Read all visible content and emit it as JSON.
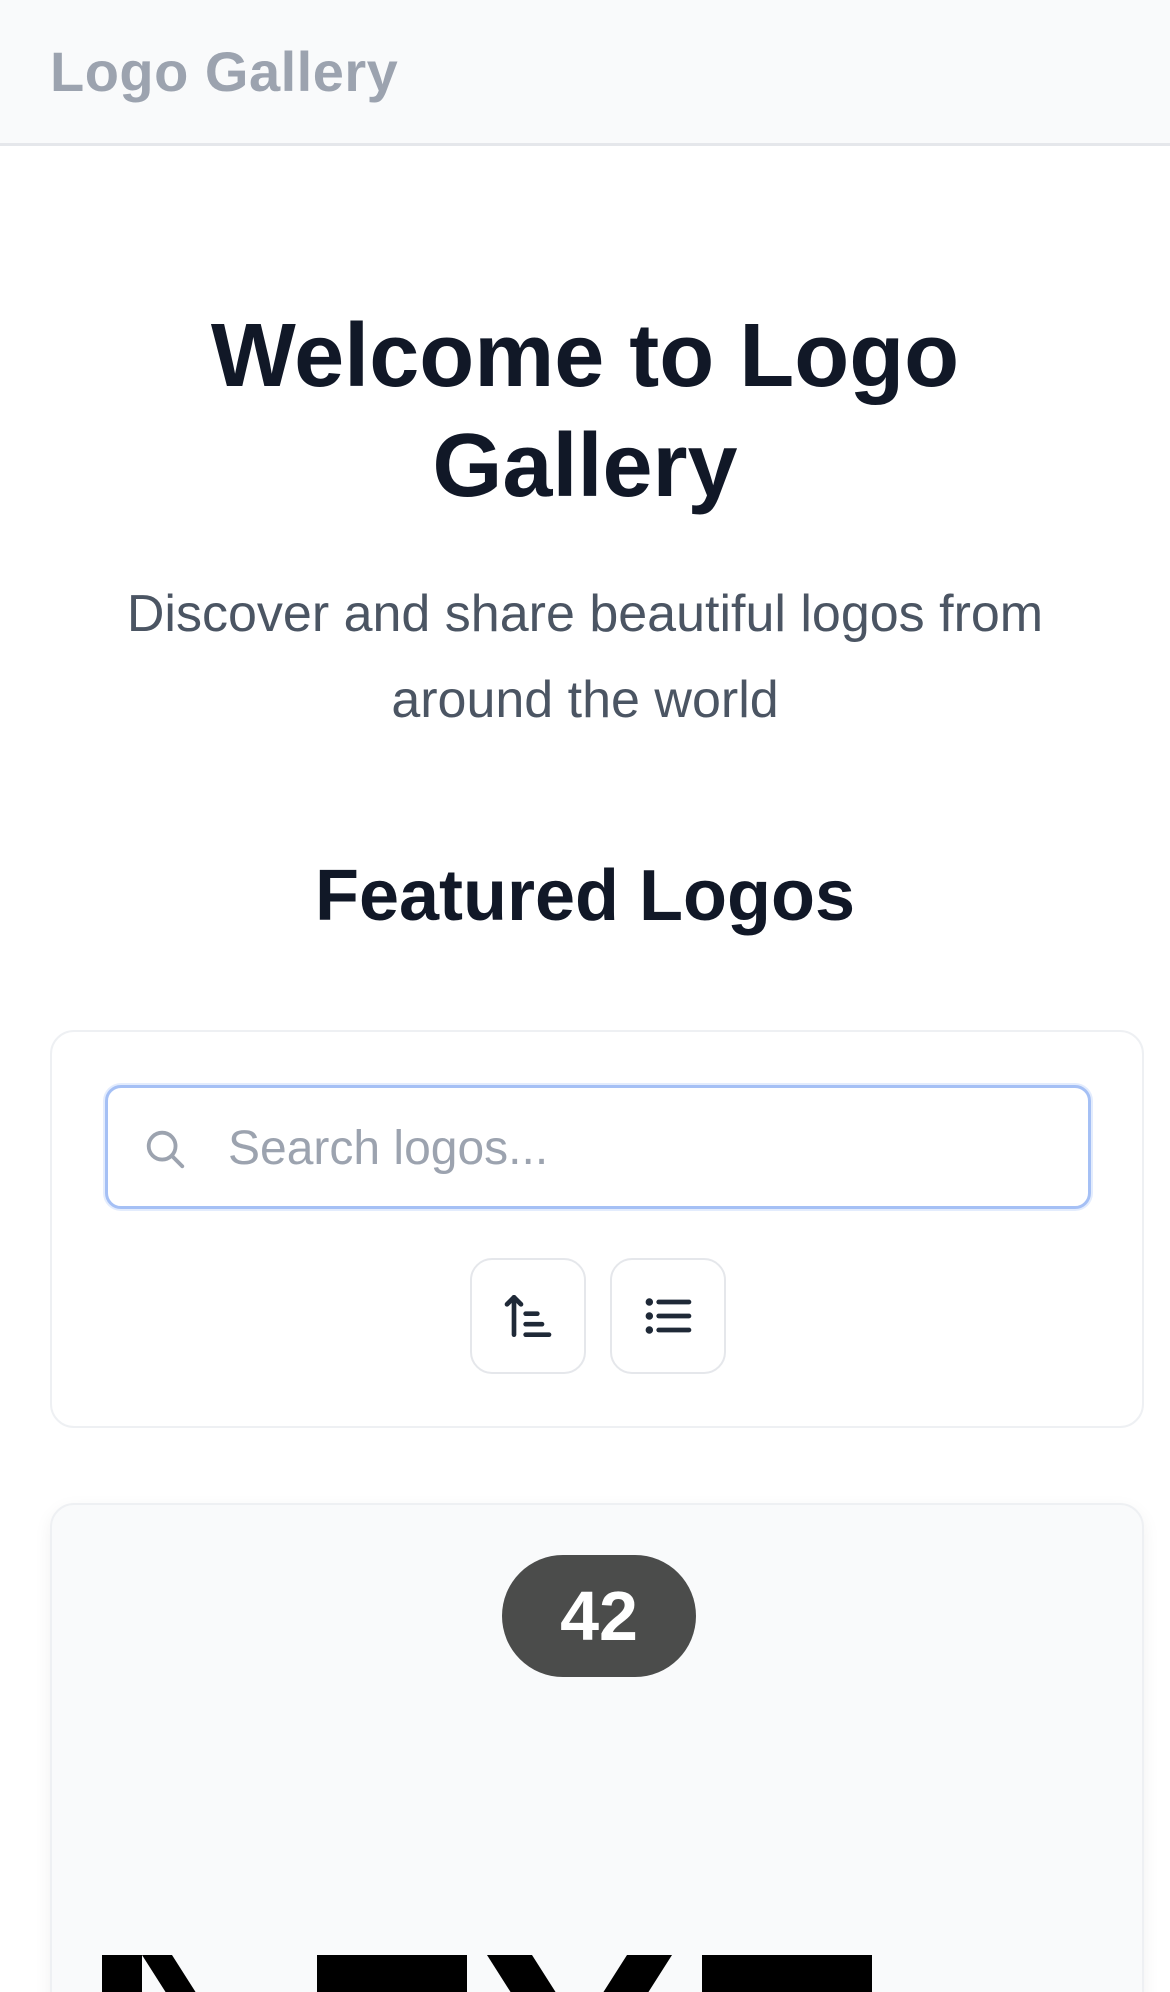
{
  "header": {
    "brand": "Logo Gallery"
  },
  "hero": {
    "title": "Welcome to Logo Gallery",
    "subtitle": "Discover and share beautiful logos from around the world"
  },
  "featured": {
    "title": "Featured Logos"
  },
  "search": {
    "placeholder": "Search logos...",
    "value": "",
    "icon": "search-icon"
  },
  "toolbar": {
    "sort_icon": "sort-ascending-icon",
    "view_icon": "list-view-icon"
  },
  "logo_card": {
    "count": "42",
    "logo_text": "NEXT"
  },
  "colors": {
    "badge": "#4b4c4b",
    "focus_ring": "#a5c0f5",
    "brand_text": "#9ca3af",
    "heading": "#111827",
    "subtitle": "#4b5563"
  }
}
